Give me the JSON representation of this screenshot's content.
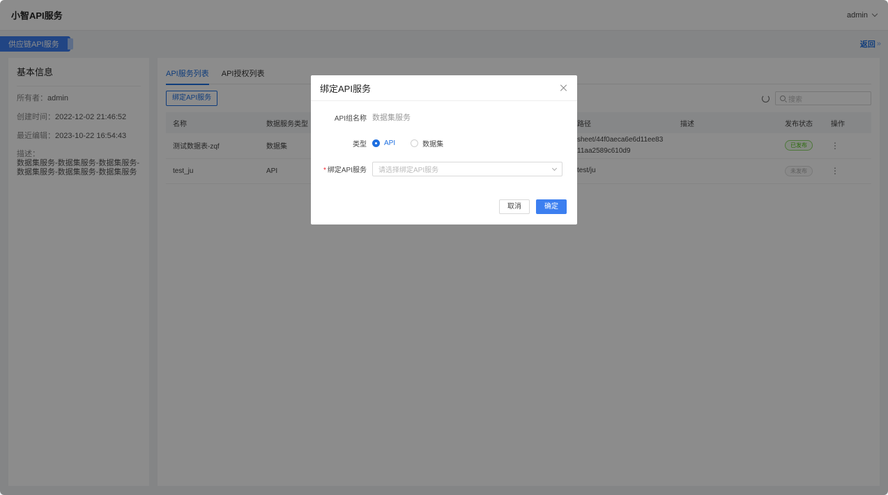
{
  "header": {
    "title": "小智API服务",
    "user": "admin"
  },
  "subheader": {
    "project_tag": "供应链API服务",
    "back_label": "返回",
    "back_icon": "»"
  },
  "info": {
    "title": "基本信息",
    "owner_label": "所有者：",
    "owner": "admin",
    "created_label": "创建时间：",
    "created": "2022-12-02 21:46:52",
    "edited_label": "最近编辑：",
    "edited": "2023-10-22 16:54:43",
    "desc_label": "描述：",
    "desc": "数据集服务-数据集服务-数据集服务-数据集服务-数据集服务-数据集服务"
  },
  "main": {
    "tabs": [
      {
        "label": "API服务列表"
      },
      {
        "label": "API授权列表"
      }
    ],
    "bind_button": "绑定API服务",
    "search_placeholder": "搜索",
    "columns": [
      "名称",
      "数据服务类型",
      "路径",
      "描述",
      "发布状态",
      "操作"
    ],
    "rows": [
      {
        "name": "测试数据表-zqf",
        "type": "数据集",
        "path": "sheet/44f0aeca6e6d11ee8311aa2589c610d9",
        "desc": "",
        "status": "已发布"
      },
      {
        "name": "test_ju",
        "type": "API",
        "path": "test/ju",
        "desc": "",
        "status": "未发布"
      }
    ],
    "more_icon": "⋮"
  },
  "modal": {
    "title": "绑定API服务",
    "group_label": "API组名称",
    "group_value": "数据集服务",
    "type_label": "类型",
    "type_options": [
      "API",
      "数据集"
    ],
    "type_selected": "API",
    "bind_label": "绑定API服务",
    "bind_placeholder": "请选择绑定API服务",
    "cancel": "取消",
    "confirm": "确定"
  },
  "colors": {
    "primary": "#3c7ff0",
    "success": "#52c41a",
    "mask": "rgba(0,0,0,0.45)"
  }
}
